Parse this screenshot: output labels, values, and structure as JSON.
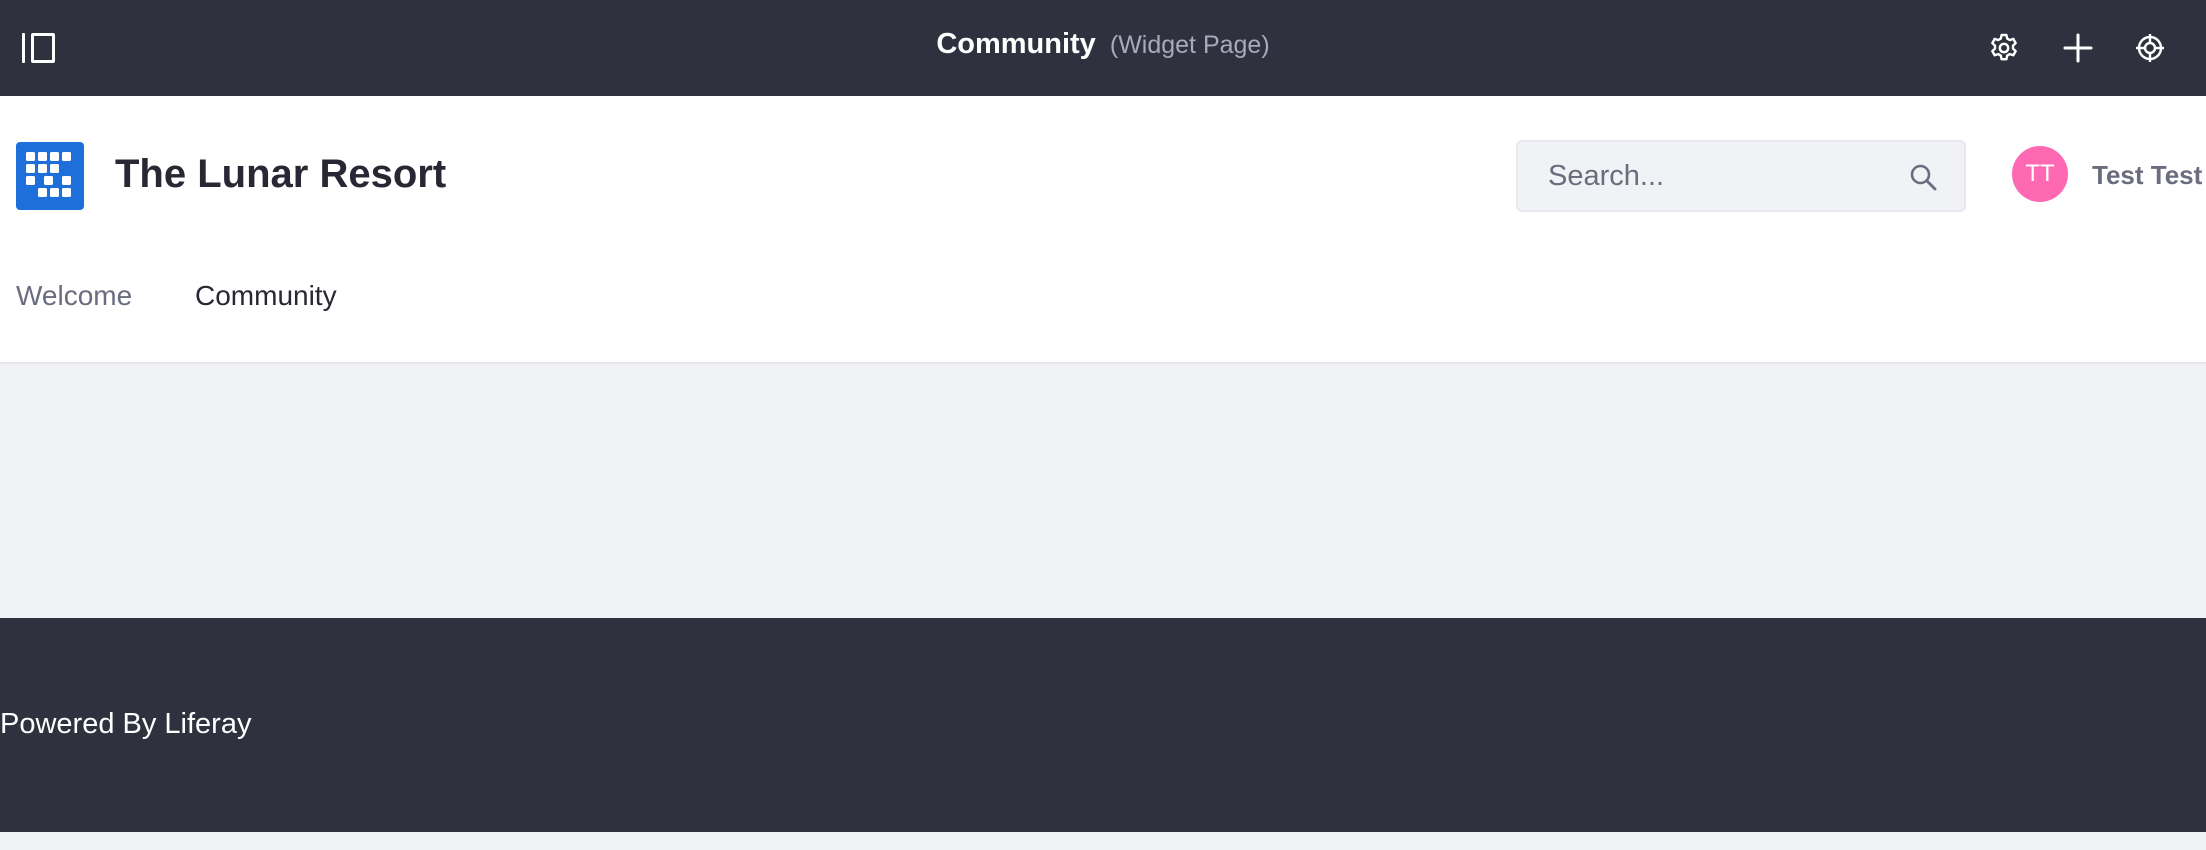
{
  "control_menu": {
    "page_title": "Community",
    "page_type": "(Widget Page)",
    "icons": {
      "sidebar_toggle": "sidebar-toggle-icon",
      "settings": "gear-icon",
      "add": "plus-icon",
      "simulation": "simulation-icon"
    }
  },
  "header": {
    "site_name": "The Lunar Resort",
    "logo": "site-logo-icon",
    "search": {
      "placeholder": "Search...",
      "value": ""
    },
    "user": {
      "initials": "TT",
      "name": "Test Test"
    }
  },
  "navigation": {
    "items": [
      {
        "label": "Welcome",
        "active": false
      },
      {
        "label": "Community",
        "active": true
      }
    ]
  },
  "footer": {
    "text": "Powered By Liferay"
  },
  "colors": {
    "control_menu_bg": "#30313f",
    "brand_blue": "#1e6fd9",
    "avatar_pink": "#ff69b4",
    "page_bg": "#f1f2f5"
  }
}
